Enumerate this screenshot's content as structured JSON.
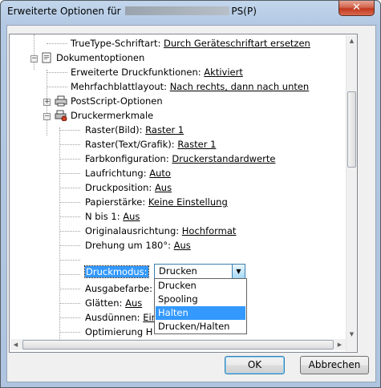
{
  "window": {
    "title_prefix": "Erweiterte Optionen für",
    "title_suffix": "PS(P)",
    "close_symbol": "✕"
  },
  "tree": {
    "truetype": {
      "label": "TrueType-Schriftart:",
      "value": "Durch Geräteschriftart ersetzen"
    },
    "dokumentoptionen": {
      "label": "Dokumentoptionen",
      "icon": "document-options-icon"
    },
    "erweiterte_druck": {
      "label": "Erweiterte Druckfunktionen:",
      "value": "Aktiviert"
    },
    "mehrfachblatt": {
      "label": "Mehrfachblattlayout:",
      "value": "Nach rechts, dann nach unten"
    },
    "postscript": {
      "label": "PostScript-Optionen",
      "icon": "postscript-icon"
    },
    "druckermerkmale": {
      "label": "Druckermerkmale",
      "icon": "printer-features-icon"
    },
    "features": [
      {
        "label": "Raster(Bild):",
        "value": "Raster 1"
      },
      {
        "label": "Raster(Text/Grafik):",
        "value": "Raster 1"
      },
      {
        "label": "Farbkonfiguration:",
        "value": "Druckerstandardwerte"
      },
      {
        "label": "Laufrichtung:",
        "value": "Auto"
      },
      {
        "label": "Druckposition:",
        "value": "Aus"
      },
      {
        "label": "Papierstärke:",
        "value": "Keine Einstellung"
      },
      {
        "label": "N bis 1:",
        "value": "Aus"
      },
      {
        "label": "Originalausrichtung:",
        "value": "Hochformat"
      },
      {
        "label": "Drehung um 180°:",
        "value": "Aus"
      }
    ],
    "druckmodus": {
      "label": "Druckmodus:",
      "selected": "Drucken"
    },
    "partial": [
      {
        "label": "Ausgabefarbe:"
      },
      {
        "label": "Glätten:",
        "value": "Aus"
      },
      {
        "label": "Ausdünnen:",
        "value": "Ein"
      },
      {
        "label": "Optimierung H"
      }
    ],
    "dropdown_options": [
      "Drucken",
      "Spooling",
      "Halten",
      "Drucken/Halten"
    ],
    "highlighted_option": "Halten"
  },
  "buttons": {
    "ok": "OK",
    "cancel": "Abbrechen"
  },
  "colors": {
    "selection": "#3399ff",
    "combo_border": "#3c7fb1"
  }
}
